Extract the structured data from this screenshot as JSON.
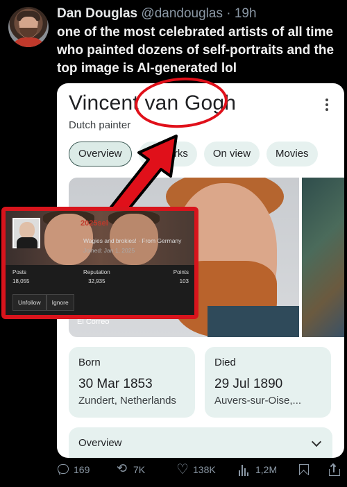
{
  "tweet": {
    "author_name": "Dan Douglas",
    "handle": "@dandouglas",
    "separator": "·",
    "time": "19h",
    "text": "one of the most celebrated artists of all time who painted dozens of self-portraits and the top image is AI-generated lol"
  },
  "knowledge_panel": {
    "title": "Vincent van Gogh",
    "subtitle": "Dutch painter",
    "chips": [
      "Overview",
      "Artworks",
      "On view",
      "Movies"
    ],
    "photo_credit": "El Correo",
    "born": {
      "label": "Born",
      "date": "30 Mar 1853",
      "place": "Zundert, Netherlands"
    },
    "died": {
      "label": "Died",
      "date": "29 Jul 1890",
      "place": "Auvers-sur-Oise,..."
    },
    "overview_label": "Overview"
  },
  "overlay_profile": {
    "username": "2025sel",
    "bio": "Wagies and brokies! · From Germany",
    "joined": "Joined: Jan 1, 2025",
    "stats": [
      {
        "label": "Posts",
        "value": "18,055"
      },
      {
        "label": "Reputation",
        "value": "32,935"
      },
      {
        "label": "Points",
        "value": "103"
      }
    ],
    "buttons": [
      "Unfollow",
      "Ignore"
    ]
  },
  "annotation_color": "#e0101a",
  "actions": {
    "replies": "169",
    "retweets": "7K",
    "likes": "138K",
    "views": "1,2M"
  }
}
